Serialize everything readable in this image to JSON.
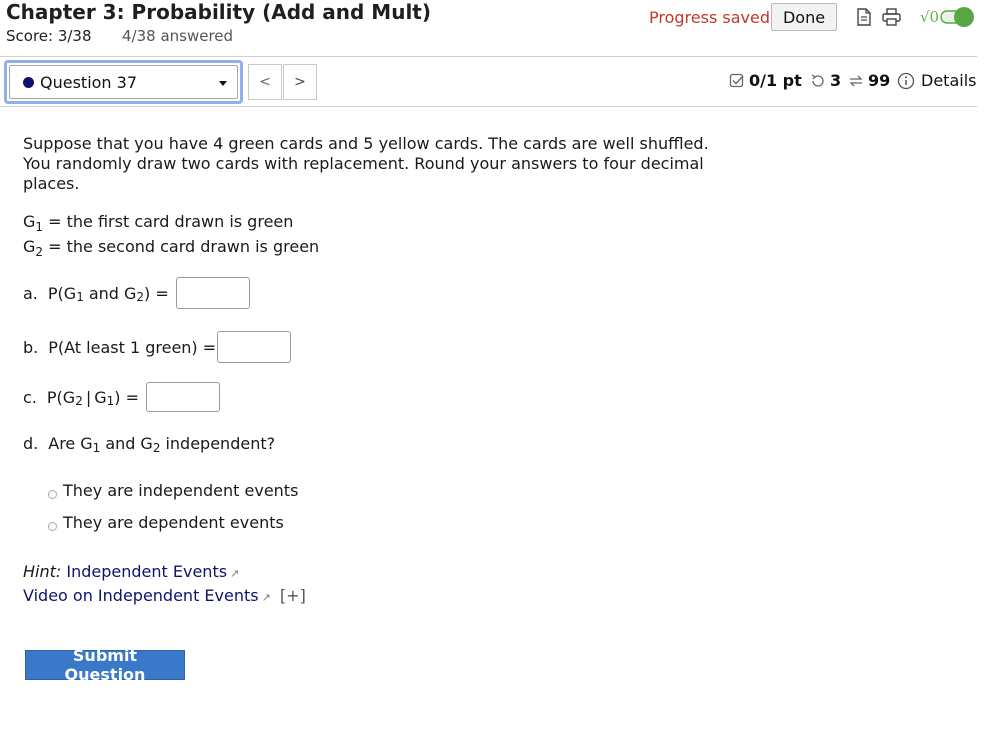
{
  "header": {
    "title": "Chapter 3: Probability (Add and Mult)",
    "score": "Score: 3/38",
    "answered": "4/38 answered",
    "progress_status": "Progress saved",
    "done_label": "Done",
    "toggle_label": "√0"
  },
  "question_nav": {
    "selected": "Question 37",
    "prev_label": "<",
    "next_label": ">",
    "points": "0/1 pt",
    "retries": "3",
    "attempts": "99",
    "details_label": "Details"
  },
  "question": {
    "text": "Suppose that you have 4 green cards and 5 yellow cards. The cards are well shuffled. You randomly draw two cards with replacement. Round your answers to four decimal places.",
    "def1_var": "G",
    "def1_sub": "1",
    "def1_text": " = the first card drawn is green",
    "def2_var": "G",
    "def2_sub": "2",
    "def2_text": " = the second card drawn is green",
    "parts": {
      "a_label": "a.",
      "b_label": "b.",
      "b_text": "P(At least 1 green) =",
      "c_label": "c.",
      "d_label": "d.",
      "d_text": "independent?",
      "d_are": "Are",
      "and": "and"
    },
    "options": [
      "They are independent events",
      "They are dependent events"
    ],
    "inputs": {
      "a": "",
      "b": "",
      "c": ""
    }
  },
  "hint": {
    "label": "Hint:",
    "link1": "Independent Events",
    "link2": "Video on Independent Events",
    "expand": "[+]"
  },
  "submit_label": "Submit Question",
  "colors": {
    "progress": "#c0392b",
    "link": "#10126e",
    "submit_bg": "#3a78c9",
    "toggle_on": "#57a845",
    "select_focus": "#8fb0ea"
  }
}
